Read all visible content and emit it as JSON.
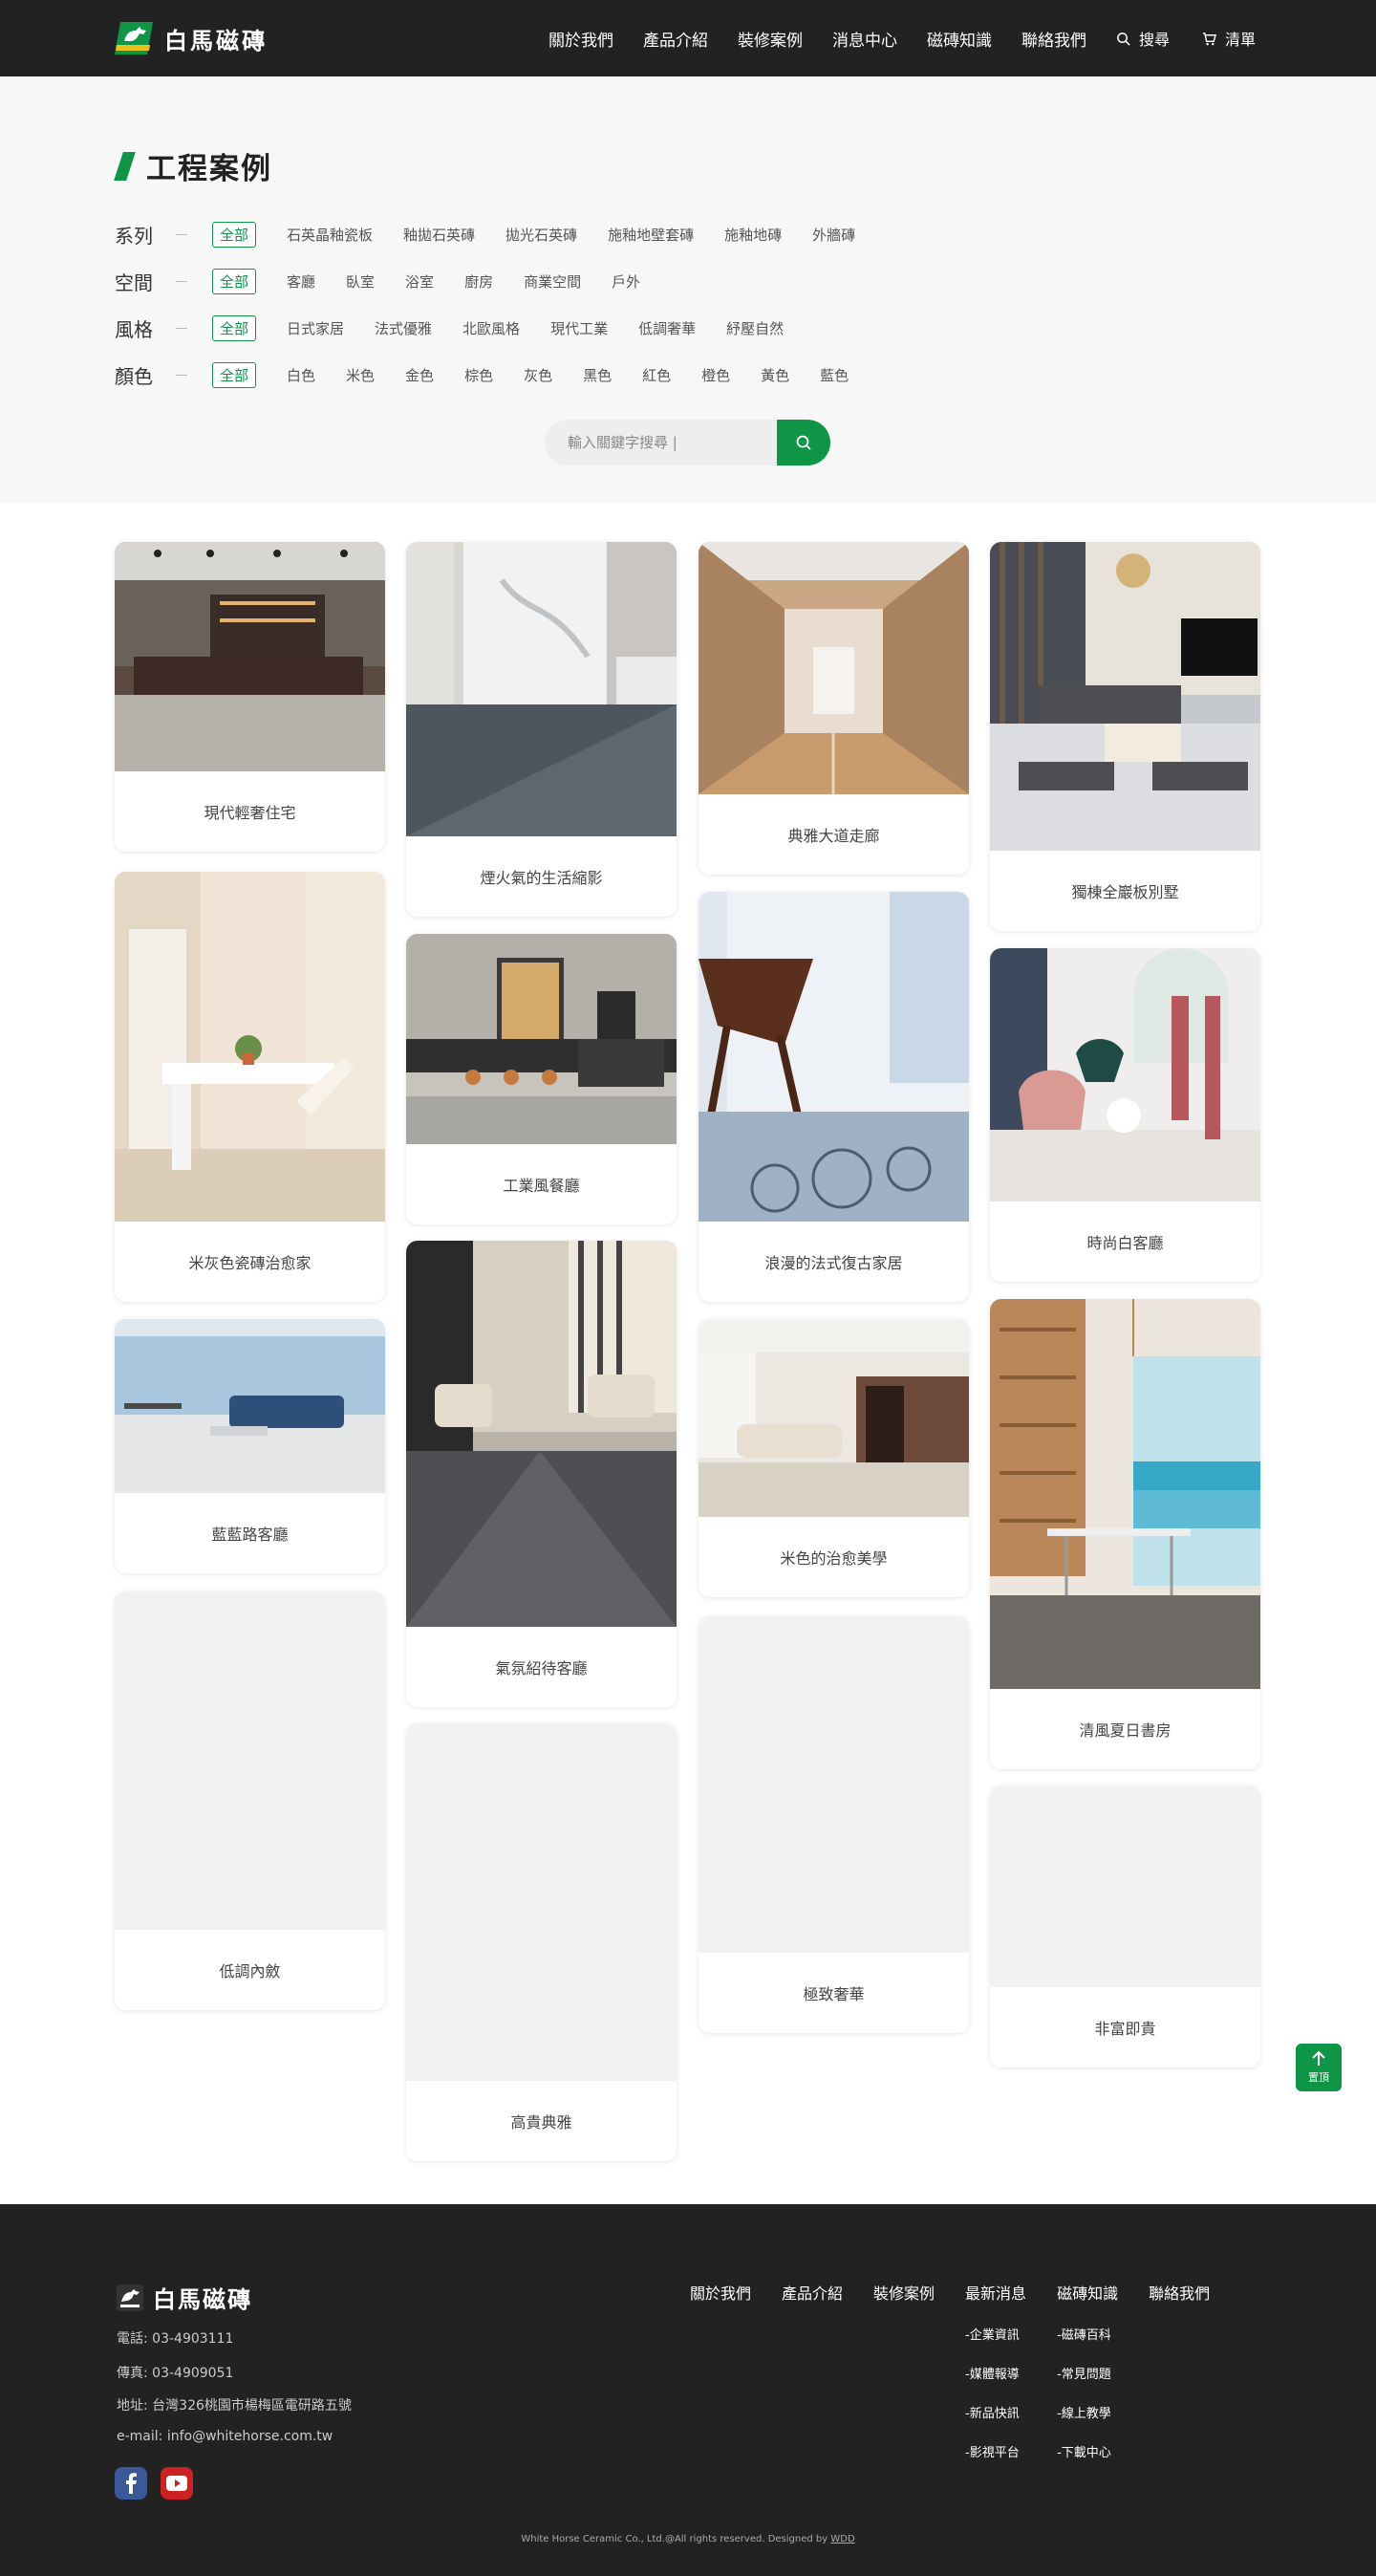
{
  "header": {
    "brand": "白馬磁磚",
    "nav": [
      "關於我們",
      "產品介紹",
      "裝修案例",
      "消息中心",
      "磁磚知識",
      "聯絡我們"
    ],
    "search_label": "搜尋",
    "cart_label": "清單"
  },
  "filters": {
    "title": "工程案例",
    "rows": [
      {
        "label": "系列",
        "options": [
          "全部",
          "石英晶釉瓷板",
          "釉拋石英磚",
          "拋光石英磚",
          "施釉地壁套磚",
          "施釉地磚",
          "外牆磚"
        ]
      },
      {
        "label": "空間",
        "options": [
          "全部",
          "客廳",
          "臥室",
          "浴室",
          "廚房",
          "商業空間",
          "戶外"
        ]
      },
      {
        "label": "風格",
        "options": [
          "全部",
          "日式家居",
          "法式優雅",
          "北歐風格",
          "現代工業",
          "低調奢華",
          "紓壓自然"
        ]
      },
      {
        "label": "顏色",
        "options": [
          "全部",
          "白色",
          "米色",
          "金色",
          "棕色",
          "灰色",
          "黑色",
          "紅色",
          "橙色",
          "黃色",
          "藍色"
        ]
      }
    ],
    "search_placeholder": "輸入關鍵字搜尋 |"
  },
  "cases": [
    "現代輕奢住宅",
    "煙火氣的生活縮影",
    "典雅大道走廊",
    "獨棟全巖板別墅",
    "米灰色瓷磚治愈家",
    "工業風餐廳",
    "浪漫的法式復古家居",
    "時尚白客廳",
    "藍藍路客廳",
    "氣氛紹待客廳",
    "米色的治愈美學",
    "清風夏日書房",
    "低調內斂",
    "高貴典雅",
    "極致奢華",
    "非富即貴"
  ],
  "back_to_top": "置頂",
  "footer": {
    "brand": "白馬磁磚",
    "phone": "電話:  03-4903111",
    "fax": "傳真:  03-4909051",
    "address": "地址:  台灣326桃園市楊梅區電研路五號",
    "email": "e-mail:  info@whitehorse.com.tw",
    "nav": [
      {
        "title": "關於我們",
        "subs": []
      },
      {
        "title": "產品介紹",
        "subs": []
      },
      {
        "title": "裝修案例",
        "subs": []
      },
      {
        "title": "最新消息",
        "subs": [
          "-企業資訊",
          "-媒體報導",
          "-新品快訊",
          "-影視平台"
        ]
      },
      {
        "title": "磁磚知識",
        "subs": [
          "-磁磚百科",
          "-常見問題",
          "-線上教學",
          "-下載中心"
        ]
      },
      {
        "title": "聯絡我們",
        "subs": []
      }
    ],
    "copyright": "White Horse Ceramic Co., Ltd.@All rights reserved. Designed by",
    "designer": "WDD"
  },
  "colors": {
    "accent": "#0e9546",
    "dark": "#222222",
    "panel": "#f7f7f7"
  }
}
